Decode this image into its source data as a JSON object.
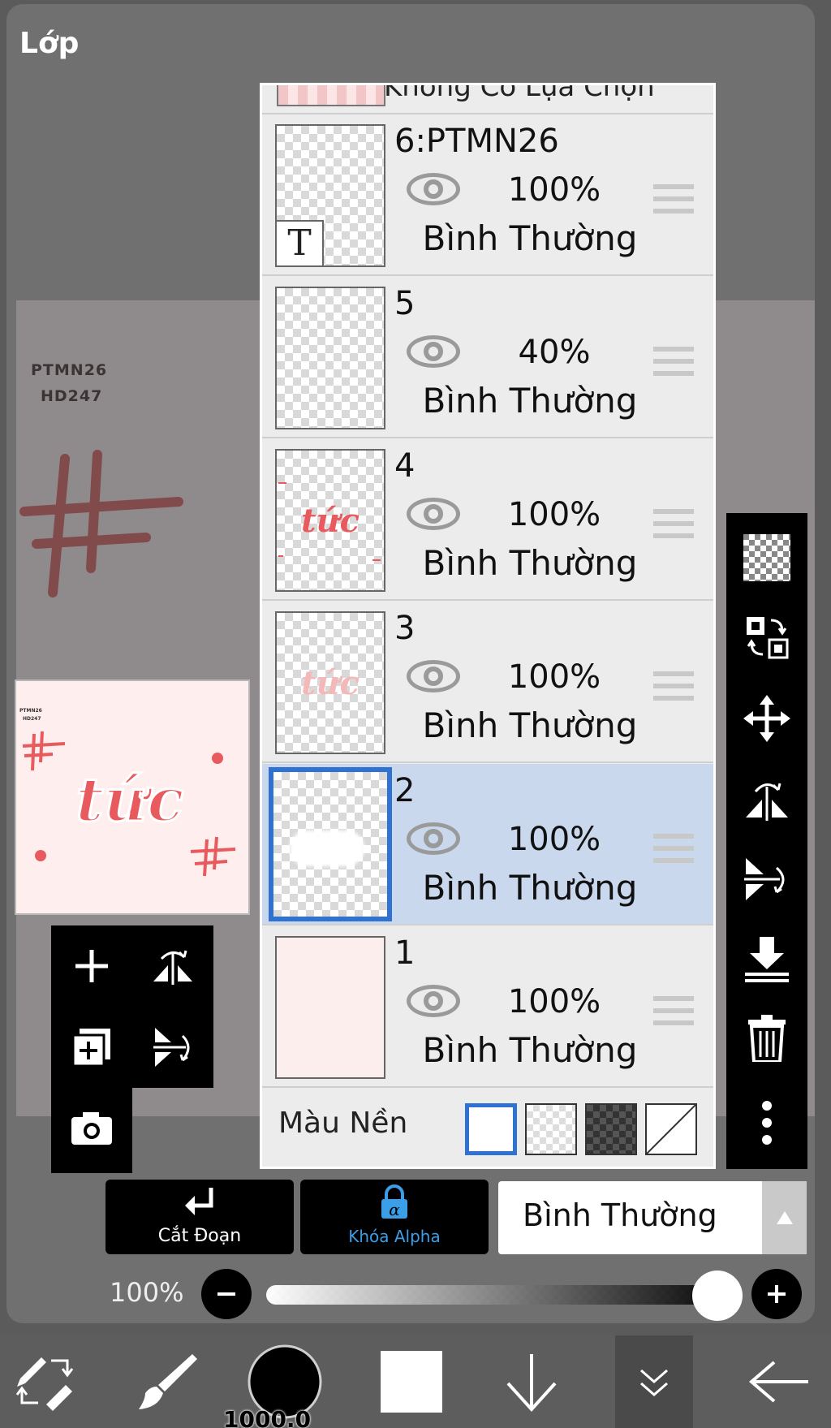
{
  "dialog": {
    "title": "Lớp"
  },
  "canvas": {
    "line1": "PTMN26",
    "line2": "HD247",
    "word": "tức"
  },
  "panel": {
    "top_partial_label": "Không Có Lựa Chọn",
    "layers": [
      {
        "name": "6:PTMN26",
        "opacity": "100%",
        "blend": "Bình Thường",
        "type_label": "T"
      },
      {
        "name": "5",
        "opacity": "40%",
        "blend": "Bình Thường"
      },
      {
        "name": "4",
        "opacity": "100%",
        "blend": "Bình Thường",
        "thumb_text": "tức"
      },
      {
        "name": "3",
        "opacity": "100%",
        "blend": "Bình Thường",
        "thumb_text": "tức"
      },
      {
        "name": "2",
        "opacity": "100%",
        "blend": "Bình Thường",
        "selected": true
      },
      {
        "name": "1",
        "opacity": "100%",
        "blend": "Bình Thường"
      }
    ],
    "background_label": "Màu Nền"
  },
  "actions": {
    "clip_label": "Cắt Đoạn",
    "alpha_lock_label": "Khóa Alpha",
    "alpha_symbol": "α"
  },
  "blend_mode": {
    "value": "Bình Thường"
  },
  "opacity": {
    "label": "100%",
    "value": 1.0
  },
  "brush": {
    "size_label": "1000.0"
  },
  "colors": {
    "selected_border": "#2f72d2",
    "selected_row": "#cad8ee",
    "accent_red": "#e85a5e",
    "alpha_icon": "#3a9ee8"
  }
}
